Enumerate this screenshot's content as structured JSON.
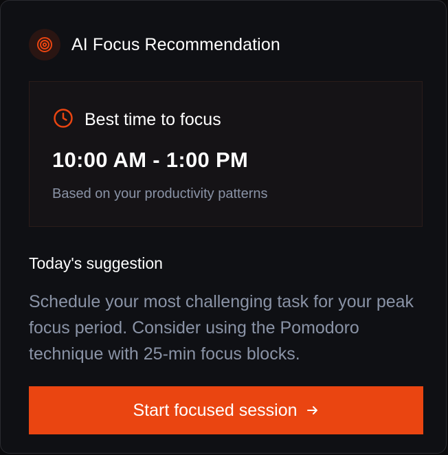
{
  "header": {
    "title": "AI Focus Recommendation",
    "icon": "target-icon"
  },
  "focus": {
    "label": "Best time to focus",
    "icon": "clock-icon",
    "time_range": "10:00 AM - 1:00 PM",
    "basis": "Based on your productivity patterns"
  },
  "suggestion": {
    "title": "Today's suggestion",
    "text": "Schedule your most challenging task for your peak focus period. Consider using the Pomodoro technique with 25-min focus blocks."
  },
  "cta": {
    "label": "Start focused session",
    "icon": "arrow-right-icon"
  },
  "colors": {
    "accent": "#ea4511",
    "background": "#0f1014",
    "muted_text": "#8a93a6"
  }
}
